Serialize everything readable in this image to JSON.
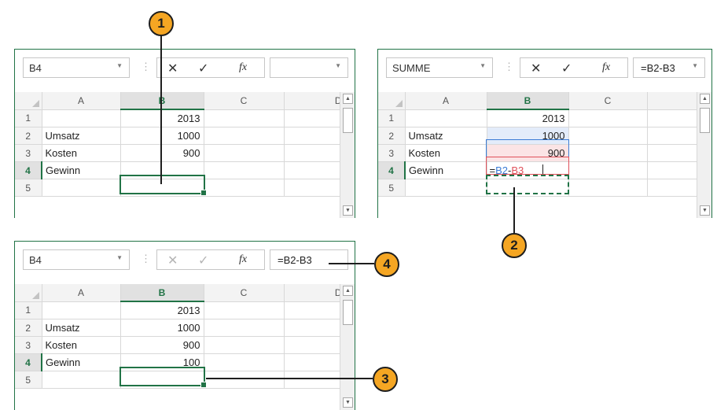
{
  "columns": [
    "A",
    "B",
    "C",
    "D"
  ],
  "rows": [
    "1",
    "2",
    "3",
    "4",
    "5"
  ],
  "cells": {
    "a2": "Umsatz",
    "a3": "Kosten",
    "a4": "Gewinn",
    "b1": "2013",
    "b2": "1000",
    "b3": "900"
  },
  "panel1": {
    "name_box": "B4",
    "formula_value": "",
    "b4_value": ""
  },
  "panel2": {
    "name_box": "SUMME",
    "formula_value": "=B2-B3",
    "b4_parts": {
      "eq": "=",
      "ref1": "B2",
      "minus": "-",
      "ref2": "B3"
    }
  },
  "panel3": {
    "name_box": "B4",
    "formula_value": "=B2-B3",
    "b4_value": "100"
  },
  "callouts": [
    "1",
    "2",
    "3",
    "4"
  ],
  "icons": {
    "cancel": "✕",
    "enter": "✓",
    "function": "fx",
    "dropdown": "▼",
    "scroll_up": "▲",
    "scroll_down": "▼"
  },
  "colors": {
    "excel_green": "#217346",
    "callout_orange": "#f5a623",
    "ref_blue": "#3a7bd5",
    "ref_red": "#e0505a"
  }
}
